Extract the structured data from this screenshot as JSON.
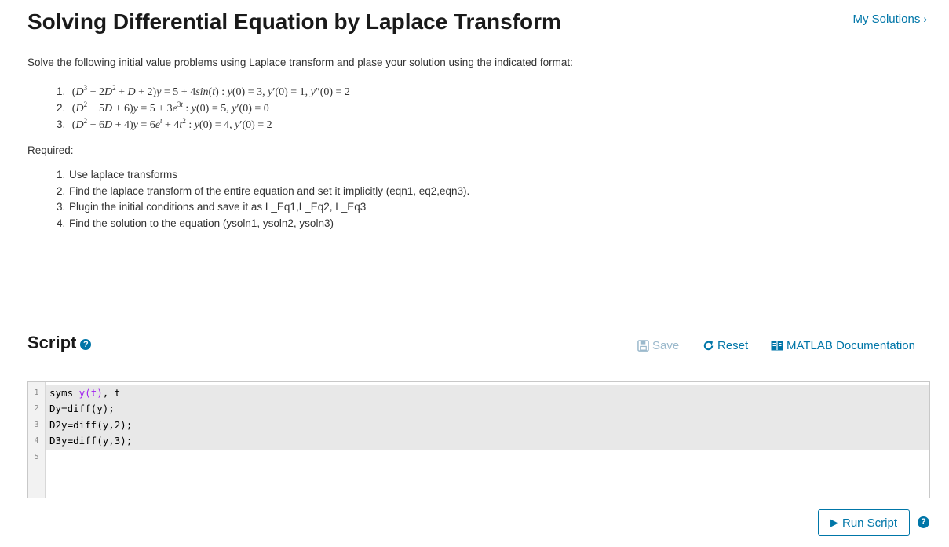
{
  "header": {
    "title": "Solving Differential Equation by Laplace Transform",
    "my_solutions": "My Solutions",
    "my_solutions_icon": "chevron-right-icon"
  },
  "description": {
    "intro": "Solve the following initial value problems using Laplace transform and plase your solution using the indicated format:",
    "problems": [
      "(D³ + 2D² + D + 2)y = 5 + 4sin(t) : y(0) = 3, y′(0) = 1, y″(0) = 2",
      "(D² + 5D + 6)y = 5 + 3e³ᵗ : y(0) = 5, y′(0) = 0",
      "(D² + 6D + 4)y = 6eᵗ + 4t² : y(0) = 4, y′(0) = 2"
    ],
    "required_label": "Required:",
    "required": [
      "Use laplace transforms",
      "Find the laplace transform of the entire equation and set it implicitly (eqn1, eq2,eqn3).",
      "Plugin the initial conditions and save it as L_Eq1,L_Eq2, L_Eq3",
      "Find the solution to the equation (ysoln1, ysoln2, ysoln3)"
    ]
  },
  "script": {
    "heading": "Script",
    "help_icon": "question-circle-icon",
    "save_label": "Save",
    "reset_label": "Reset",
    "docs_label": "MATLAB Documentation",
    "code_lines": [
      "syms y(t), t",
      "Dy=diff(y);",
      "D2y=diff(y,2);",
      "D3y=diff(y,3);",
      ""
    ],
    "line_numbers": [
      "1",
      "2",
      "3",
      "4",
      "5"
    ],
    "run_label": "Run Script"
  },
  "colors": {
    "link": "#0076a8",
    "save_disabled": "#9bb9cc",
    "syntax_variable": "#a020f0"
  }
}
